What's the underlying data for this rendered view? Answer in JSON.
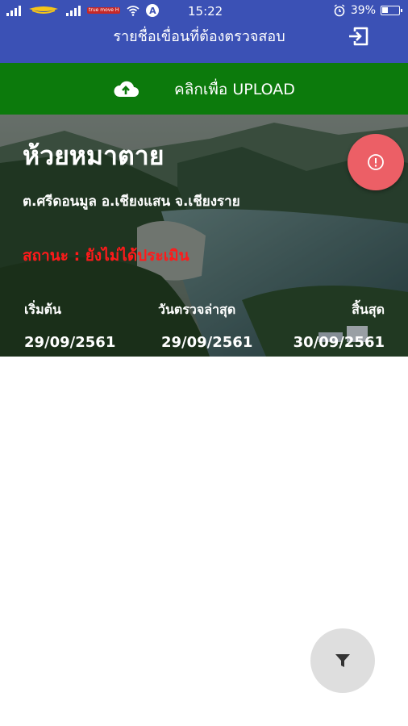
{
  "status_bar": {
    "carrier_tag": "true move H",
    "time": "15:22",
    "battery": "39%",
    "battery_level": 0.39,
    "icons": [
      "signal-icon",
      "carrier-icon",
      "signal-icon",
      "wifi-icon",
      "a-icon",
      "alarm-icon",
      "battery-icon"
    ]
  },
  "app_bar": {
    "title": "รายชื่อเขื่อนที่ต้องตรวจสอบ",
    "action_icon": "logout-icon"
  },
  "upload": {
    "icon": "cloud-upload-icon",
    "label": "คลิกเพื่อ UPLOAD",
    "color": "#0c7a0c"
  },
  "dam_card": {
    "name": "ห้วยหมาตาย",
    "location": "ต.ศรีดอนมูล อ.เชียงแสน จ.เชียงราย",
    "status": "สถานะ : ยังไม่ได้ประเมิน",
    "status_color": "#ff1a1a",
    "columns": [
      {
        "header": "เริ่มต้น",
        "value": "29/09/2561"
      },
      {
        "header": "วันตรวจล่าสุด",
        "value": "29/09/2561"
      },
      {
        "header": "สิ้นสุด",
        "value": "30/09/2561"
      }
    ],
    "alert_icon": "alert-circle-icon",
    "alert_color": "#ec5f66"
  },
  "fab": {
    "icon": "filter-icon"
  },
  "colors": {
    "primary": "#3b51b5"
  }
}
